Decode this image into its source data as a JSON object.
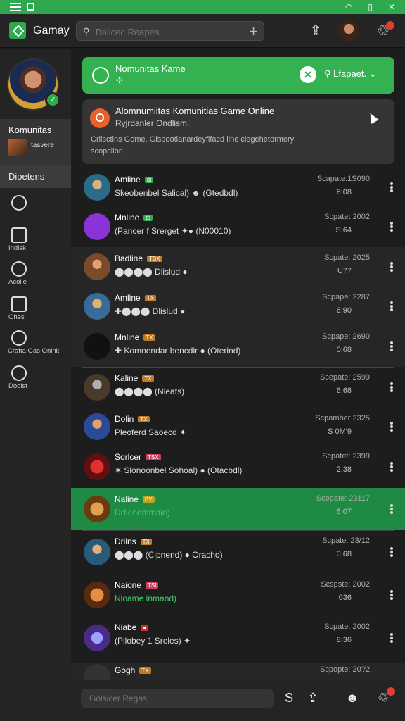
{
  "topbar": {
    "app_title": "Gamay",
    "search_placeholder": "Baiicec Reapes"
  },
  "sidebar": {
    "active_title": "Komunitas",
    "active_sub": "tasvere",
    "section": "Dioetens",
    "items": [
      {
        "label": ""
      },
      {
        "label": "Indisk"
      },
      {
        "label": "Acolle"
      },
      {
        "label": "Ohes"
      },
      {
        "label": "Crafta Gas Onlnk"
      },
      {
        "label": "Doolst"
      }
    ]
  },
  "banner": {
    "title": "Nomunitas Kame",
    "subtitle": "✣",
    "filter_label": "Lfapaet."
  },
  "card": {
    "title": "Alomnumiitas Komunitias Game Online",
    "subtitle": "Ryjrdanler Ondlism.",
    "body": "Criisctins Gome. Gispootlanardeyfifacd line clegehetormery scopclion."
  },
  "rows": [
    {
      "name": "Amline",
      "tag": "⊞",
      "desc": "Skeobenbel Salical) ☻ (Gtedbdl)",
      "date": "Scapate:1S090",
      "time": "6:08"
    },
    {
      "name": "Mnline",
      "tag": "⊞",
      "desc": "(Pancer f Srerget ✦● (N00010)",
      "date": "Scpatet 2002",
      "time": "S:64"
    },
    {
      "name": "Badline",
      "tag": "TBX",
      "desc": "⬤⬤⬤⬤ Dlislud ●",
      "date": "Scpate: 2025",
      "time": "U77"
    },
    {
      "name": "Amline",
      "tag": "TX",
      "desc": "✚⬤⬤⬤ Dlislud ●",
      "date": "Scpape: 2287",
      "time": "6:90"
    },
    {
      "name": "Mnline",
      "tag": "TX",
      "desc": "✚ Komoendar bencdir ● (Oterind)",
      "date": "Scpape: 2690",
      "time": "0:68"
    },
    {
      "name": "Kaline",
      "tag": "TX",
      "desc": "⬤⬤⬤⬤ (Nleats)",
      "date": "Scepate: 2599",
      "time": "6:68"
    },
    {
      "name": "Dolin",
      "tag": "TX",
      "desc": "Pleoferd Saoecd ✦",
      "date": "Scpamber 2325",
      "time": "S 0M'9"
    },
    {
      "name": "Sorlcer",
      "tag": "TSX",
      "desc": "✶ Slonoonbel Sohoal) ● (Otacbdl)",
      "date": "Scpatet: 2399",
      "time": "2:38"
    },
    {
      "name": "Naline",
      "tag": "BY",
      "desc": "Drfienemmale)",
      "date": "Scepate: 23117",
      "time": "6 07"
    },
    {
      "name": "Drilns",
      "tag": "TX",
      "desc": "⬤⬤⬤ (Cipnend) ● Oracho)",
      "date": "Scpate: 23/12",
      "time": "0.68"
    },
    {
      "name": "Naione",
      "tag": "TSI",
      "desc": "Nloame inmand)",
      "date": "Scspste: 2002",
      "time": "036"
    },
    {
      "name": "Niabe",
      "tag": "●",
      "desc": "(Pilobey 1 Sreles) ✦",
      "date": "Scpate: 2002",
      "time": "8:36"
    },
    {
      "name": "Gogh",
      "tag": "TX",
      "desc": "",
      "date": "Scpopte: 20?2",
      "time": ""
    }
  ],
  "bottom": {
    "input_placeholder": "Golsicer Regas"
  }
}
